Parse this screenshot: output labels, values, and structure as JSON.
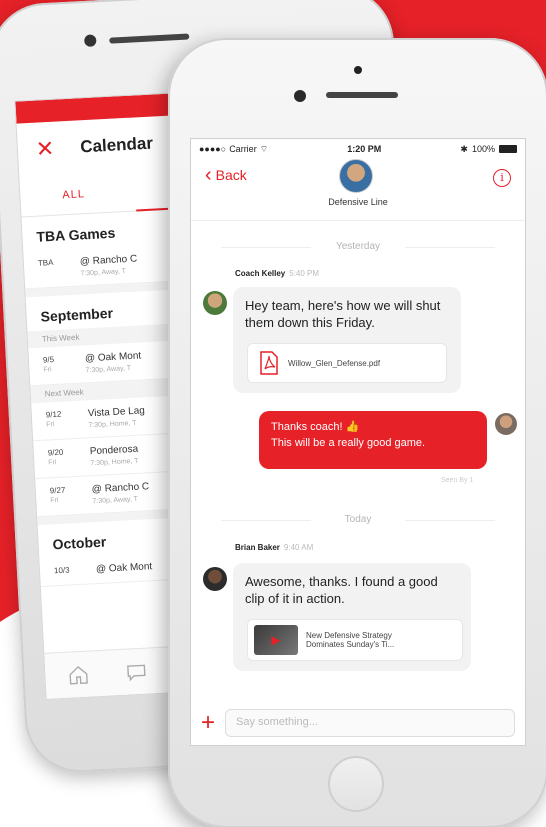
{
  "colors": {
    "brand_red": "#e62128"
  },
  "back_phone": {
    "close_icon": "close-icon",
    "title": "Calendar",
    "tab_all": "ALL",
    "tba_section": "TBA Games",
    "tba_game": {
      "date": "TBA",
      "opponent": "@ Rancho C",
      "detail": "7:30p, Away, T"
    },
    "september_section": "September",
    "this_week": "This Week",
    "next_week": "Next Week",
    "games": [
      {
        "date": "9/5",
        "day": "Fri",
        "opponent": "@ Oak Mont",
        "detail": "7:30p, Away, T"
      },
      {
        "date": "9/12",
        "day": "Fri",
        "opponent": "Vista De Lag",
        "detail": "7:30p, Home, T"
      },
      {
        "date": "9/20",
        "day": "Fri",
        "opponent": "Ponderosa",
        "detail": "7:30p, Home, T"
      },
      {
        "date": "9/27",
        "day": "Fri",
        "opponent": "@ Rancho C",
        "detail": "7:30p, Away, T"
      }
    ],
    "october_section": "October",
    "october_game": {
      "date": "10/3",
      "opponent": "@ Oak Mont"
    }
  },
  "status_bar": {
    "carrier": "Carrier",
    "time": "1:20 PM",
    "battery": "100%"
  },
  "nav": {
    "back_label": "Back",
    "group_name": "Defensive Line",
    "info_icon": "info-icon"
  },
  "chat": {
    "divider_yesterday": "Yesterday",
    "msg1": {
      "sender": "Coach Kelley",
      "time": "5:40 PM",
      "text": "Hey team, here's how we will shut them down this Friday.",
      "attachment": "Willow_Glen_Defense.pdf"
    },
    "msg2": {
      "line1": "Thanks coach! 👍",
      "line2": "This will be a really good game.",
      "seen": "Seen By 1"
    },
    "divider_today": "Today",
    "msg3": {
      "sender": "Brian Baker",
      "time": "9:40 AM",
      "text": "Awesome, thanks. I found a good clip of it in action.",
      "link_title": "New Defensive Strategy",
      "link_sub": "Dominates Sunday's Ti..."
    }
  },
  "composer": {
    "placeholder": "Say something..."
  }
}
